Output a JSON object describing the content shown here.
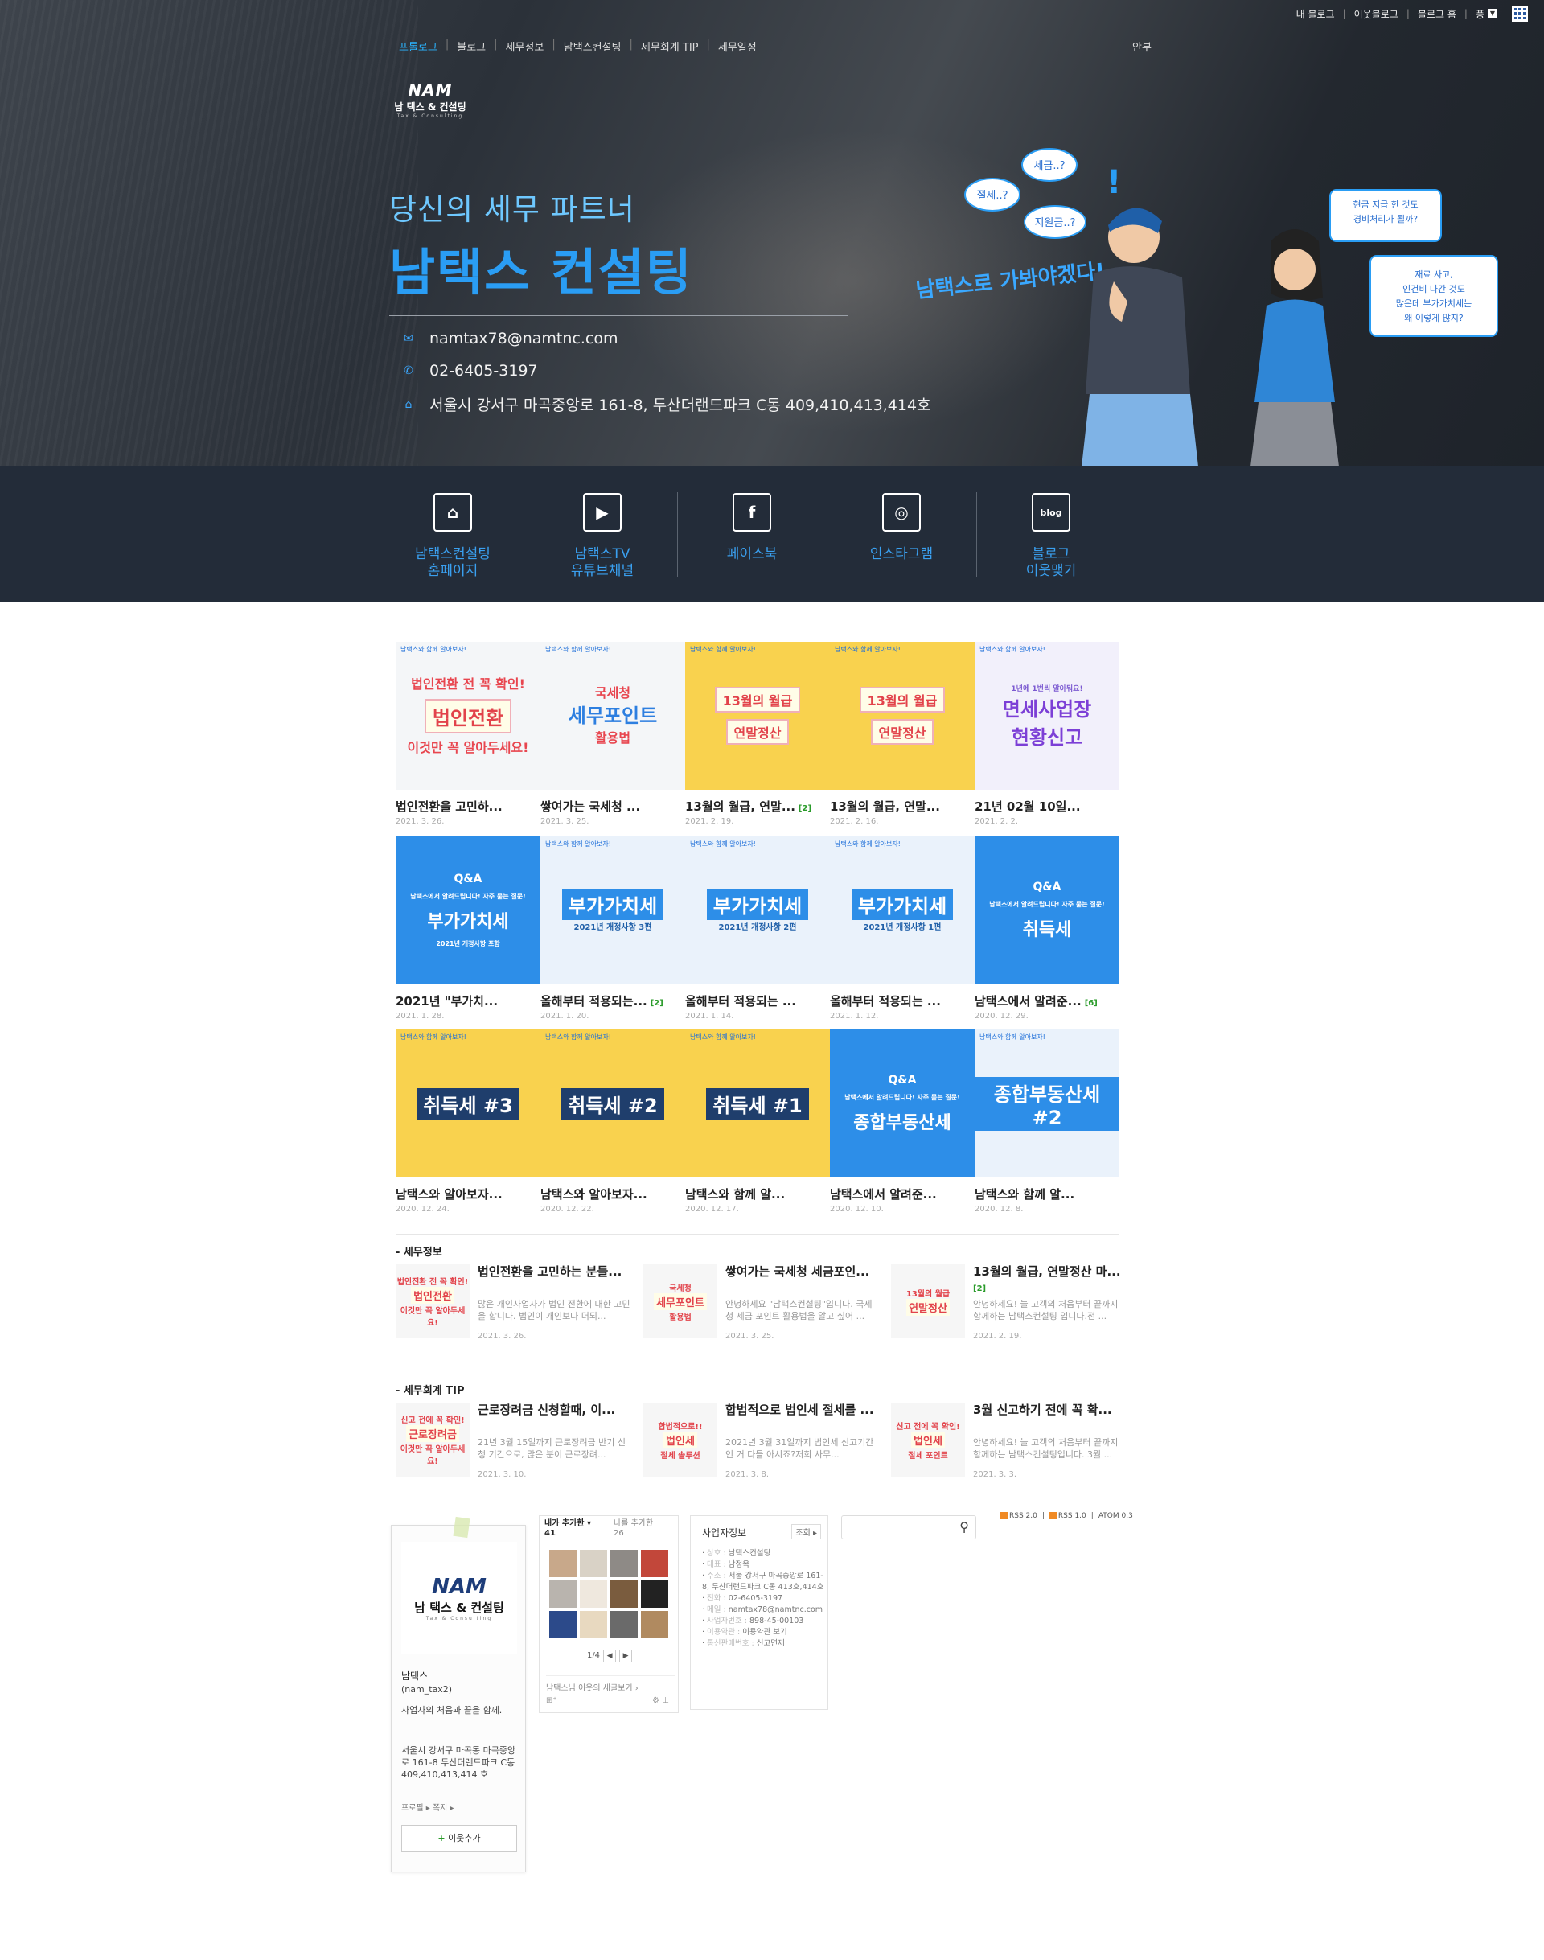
{
  "topbar": {
    "my_blog": "내 블로그",
    "neighbor_blog": "이웃블로그",
    "blog_home": "블로그 홈",
    "user": "퐁"
  },
  "menu": {
    "items": [
      "프롤로그",
      "블로그",
      "세무정보",
      "남택스컨설팅",
      "세무회계 TIP",
      "세무일정"
    ],
    "guide": "안부"
  },
  "logo": {
    "mark": "NAM",
    "name": "남 택스 & 컨설팅",
    "sub": "Tax & Consulting"
  },
  "hero": {
    "tagline": "당신의 세무 파트너",
    "title": "남택스 컨설팅",
    "email": "namtax78@namtnc.com",
    "phone": "02-6405-3197",
    "address": "서울시 강서구 마곡중앙로  161-8, 두산더랜드파크 C동 409,410,413,414호",
    "bubbles": [
      "세금..?",
      "절세..?",
      "지원금..?",
      "남택스로 가봐야겠다!",
      "현금 지급 한 것도 경비처리가 될까?",
      "재료 사고, 인건비 나간 것도 많은데 부가가치세는 왜 이렇게 많지?"
    ]
  },
  "shortcuts": [
    {
      "icon": "home-icon",
      "glyph": "⌂",
      "label1": "남택스컨설팅",
      "label2": "홈페이지"
    },
    {
      "icon": "youtube-icon",
      "glyph": "▶",
      "label1": "남택스TV",
      "label2": "유튜브채널"
    },
    {
      "icon": "facebook-icon",
      "glyph": "f",
      "label1": "페이스북",
      "label2": ""
    },
    {
      "icon": "instagram-icon",
      "glyph": "◎",
      "label1": "인스타그램",
      "label2": ""
    },
    {
      "icon": "blog-icon",
      "glyph": "blog",
      "label1": "블로그",
      "label2": "이웃맺기"
    }
  ],
  "posts": [
    {
      "title": "법인전환을 고민하...",
      "date": "2021. 3. 26.",
      "comments": "",
      "thumb_lines": [
        "법인전환 전 꼭 확인!",
        "법인전환",
        "이것만 꼭 알아두세요!"
      ],
      "style": "white",
      "strip": "남택스와 함께 알아보자!"
    },
    {
      "title": "쌓여가는 국세청 ...",
      "date": "2021. 3. 25.",
      "comments": "",
      "thumb_lines": [
        "국세청",
        "세무포인트",
        "활용법"
      ],
      "style": "white",
      "strip": "남택스와 함께 알아보자!"
    },
    {
      "title": "13월의 월급, 연말...",
      "date": "2021. 2. 19.",
      "comments": "[2]",
      "thumb_lines": [
        "13월의 월급",
        "연말정산"
      ],
      "style": "yellow",
      "strip": "남택스와 함께 알아보자!"
    },
    {
      "title": "13월의 월급, 연말...",
      "date": "2021. 2. 16.",
      "comments": "",
      "thumb_lines": [
        "13월의 월급",
        "연말정산"
      ],
      "style": "yellow",
      "strip": "남택스와 함께 알아보자!"
    },
    {
      "title": "21년 02월 10일...",
      "date": "2021. 2. 2.",
      "comments": "",
      "thumb_lines": [
        "1년에 1번씩 알아둬요!",
        "면세사업장",
        "현황신고"
      ],
      "style": "lav",
      "strip": "남택스와 함께 알아보자!"
    },
    {
      "title": "2021년 \"부가치...",
      "date": "2021. 1. 28.",
      "comments": "",
      "thumb_lines": [
        "Q&A",
        "남택스에서 알려드립니다! 자주 묻는 질문!",
        "부가가치세",
        "2021년 개정사항 포함"
      ],
      "style": "blue",
      "strip": ""
    },
    {
      "title": "올해부터 적용되는...",
      "date": "2021. 1. 20.",
      "comments": "[2]",
      "thumb_lines": [
        "부가가치세",
        "2021년 개정사항 3편"
      ],
      "style": "lightblue",
      "strip": "남택스와 함께 알아보자!"
    },
    {
      "title": "올해부터 적용되는 ...",
      "date": "2021. 1. 14.",
      "comments": "",
      "thumb_lines": [
        "부가가치세",
        "2021년 개정사항 2편"
      ],
      "style": "lightblue",
      "strip": "남택스와 함께 알아보자!"
    },
    {
      "title": "올해부터 적용되는 ...",
      "date": "2021. 1. 12.",
      "comments": "",
      "thumb_lines": [
        "부가가치세",
        "2021년 개정사항 1편"
      ],
      "style": "lightblue",
      "strip": "남택스와 함께 알아보자!"
    },
    {
      "title": "남택스에서 알려준...",
      "date": "2020. 12. 29.",
      "comments": "[6]",
      "thumb_lines": [
        "Q&A",
        "남택스에서 알려드립니다! 자주 묻는 질문!",
        "취득세"
      ],
      "style": "blue",
      "strip": ""
    },
    {
      "title": "남택스와 알아보자...",
      "date": "2020. 12. 24.",
      "comments": "",
      "thumb_lines": [
        "취득세 #3"
      ],
      "style": "yellow",
      "strip": "남택스와 함께 알아보자!"
    },
    {
      "title": "남택스와 알아보자...",
      "date": "2020. 12. 22.",
      "comments": "",
      "thumb_lines": [
        "취득세 #2"
      ],
      "style": "yellow",
      "strip": "남택스와 함께 알아보자!"
    },
    {
      "title": "남택스와 함께 알...",
      "date": "2020. 12. 17.",
      "comments": "",
      "thumb_lines": [
        "취득세 #1"
      ],
      "style": "yellow",
      "strip": "남택스와 함께 알아보자!"
    },
    {
      "title": "남택스에서 알려준...",
      "date": "2020. 12. 10.",
      "comments": "",
      "thumb_lines": [
        "Q&A",
        "남택스에서 알려드립니다! 자주 묻는 질문!",
        "종합부동산세"
      ],
      "style": "blue",
      "strip": ""
    },
    {
      "title": "남택스와 함께 알...",
      "date": "2020. 12. 8.",
      "comments": "",
      "thumb_lines": [
        "종합부동산세 #2"
      ],
      "style": "lightblue",
      "strip": "남택스와 함께 알아보자!"
    }
  ],
  "section1": {
    "heading": "세무정보",
    "items": [
      {
        "title": "법인전환을 고민하는 분들...",
        "summary": "많은 개인사업자가 법인 전환에 대한 고민을 합니다. 법인이 개인보다 더되...",
        "date": "2021. 3. 26.",
        "comments": "",
        "thumb": [
          "법인전환 전 꼭 확인!",
          "법인전환",
          "이것만 꼭 알아두세요!"
        ]
      },
      {
        "title": "쌓여가는 국세청 세금포인...",
        "summary": "안녕하세요 \"남택스컨설팅\"입니다. 국세청 세금 포인트 활용법을 알고 싶어 ...",
        "date": "2021. 3. 25.",
        "comments": "",
        "thumb": [
          "국세청",
          "세무포인트",
          "활용법"
        ]
      },
      {
        "title": "13월의 월급, 연말정산 마...",
        "summary": "안녕하세요! 늘 고객의 처음부터 끝까지 함께하는 남택스컨설팅 입니다.전 ...",
        "date": "2021. 2. 19.",
        "comments": "[2]",
        "thumb": [
          "13월의 월급",
          "연말정산"
        ]
      }
    ]
  },
  "section2": {
    "heading": "세무회계 TIP",
    "items": [
      {
        "title": "근로장려금 신청할때, 이...",
        "summary": "21년 3월 15일까지 근로장려금 반기 신청 기간으로, 많은 분이 근로장려...",
        "date": "2021. 3. 10.",
        "comments": "",
        "thumb": [
          "신고 전에 꼭 확인!",
          "근로장려금",
          "이것만 꼭 알아두세요!"
        ]
      },
      {
        "title": "합법적으로 법인세 절세를 ...",
        "summary": "2021년 3월 31일까지 법인세 신고기간인 거 다들 아시죠?저희 사무...",
        "date": "2021. 3. 8.",
        "comments": "",
        "thumb": [
          "합법적으로!!",
          "법인세",
          "절세 솔루션"
        ]
      },
      {
        "title": "3월 신고하기 전에 꼭 확...",
        "summary": "안녕하세요! 늘 고객의 처음부터 끝까지 함께하는 남택스컨설팅입니다. 3월 ...",
        "date": "2021. 3. 3.",
        "comments": "",
        "thumb": [
          "신고 전에 꼭 확인!",
          "법인세",
          "절세 포인트"
        ]
      }
    ]
  },
  "profile": {
    "nickname": "남택스",
    "id": "(nam_tax2)",
    "intro": "사업자의 처음과 끝을 함께.",
    "address": "서울시 강서구 마곡동 마곡중앙로 161-8 두산더랜드파크 C동 409,410,413,414 호",
    "links": "프로필 ▸  쪽지 ▸",
    "add_neighbor": "이웃추가"
  },
  "neighbors": {
    "tab1": "내가 추가한",
    "tab1_count": "41",
    "tab2": "나를 추가한",
    "tab2_count": "26",
    "page": "1/4",
    "footer": "남택스님 이웃의 새글보기 ›",
    "colors": [
      "#c8a88a",
      "#d9d2c6",
      "#8e8a86",
      "#c2473a",
      "#b9b4ae",
      "#efe8de",
      "#7a5c3e",
      "#222222",
      "#2c4a8a",
      "#e8d9c0",
      "#6a6a6a",
      "#b08a60"
    ]
  },
  "business": {
    "title": "사업자정보",
    "toggle_label": "조회",
    "rows": [
      {
        "k": "상호",
        "v": "남택스컨설팅"
      },
      {
        "k": "대표",
        "v": "남정옥"
      },
      {
        "k": "주소",
        "v": "서울 강서구 마곡중앙로 161-8, 두산더랜드파크 C동 413호,414호"
      },
      {
        "k": "전화",
        "v": "02-6405-3197"
      },
      {
        "k": "메일",
        "v": "namtax78@namtnc.com"
      },
      {
        "k": "사업자번호",
        "v": "898-45-00103"
      },
      {
        "k": "이용약관",
        "v": "이용약관 보기"
      },
      {
        "k": "통신판매번호",
        "v": "신고면제"
      }
    ]
  },
  "rss": {
    "r1": "RSS 2.0",
    "r2": "RSS 1.0",
    "r3": "ATOM 0.3"
  },
  "colors": {
    "accent": "#2a9df4",
    "dark_bar": "#232c39"
  }
}
